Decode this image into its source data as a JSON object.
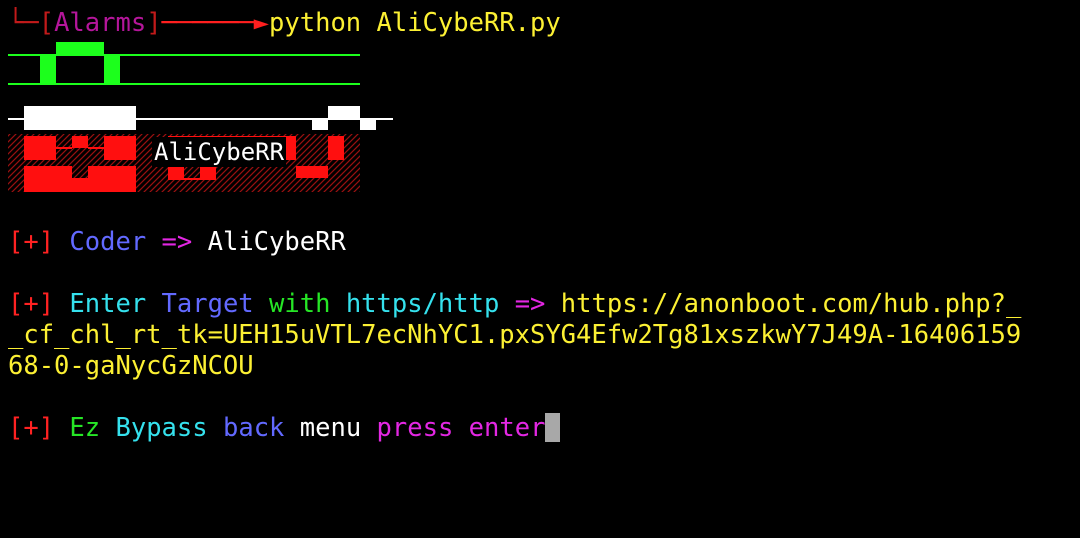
{
  "terminal": {
    "prompt": {
      "context": "Alarms",
      "command": "python AliCybeRR.py"
    },
    "banner": {
      "name": "AliCybeRR",
      "colors": {
        "top": "#1cff1c",
        "middle": "#ffffff",
        "bottom": "#ff0f0f"
      }
    },
    "coder_line": {
      "marker": "[+]",
      "label": "Coder",
      "arrow": "=>",
      "value": "AliCybeRR"
    },
    "target_line": {
      "marker": "[+]",
      "word1": "Enter",
      "word2": "Target",
      "word3": "with",
      "word4": "https/http",
      "arrow": "=>",
      "url_part1": "https://anonboot.com/hub.php?_",
      "url_part2": "_cf_chl_rt_tk=UEH15uVTL7ecNhYC1.pxSYG4Efw2Tg81xszkwY7J49A-16406159",
      "url_part3": "68-0-gaNycGzNCOU"
    },
    "bypass_line": {
      "marker": "[+]",
      "word1": "Ez",
      "word2": "Bypass",
      "word3": "back",
      "word4": "menu",
      "word5": "press",
      "word6": "enter"
    }
  }
}
